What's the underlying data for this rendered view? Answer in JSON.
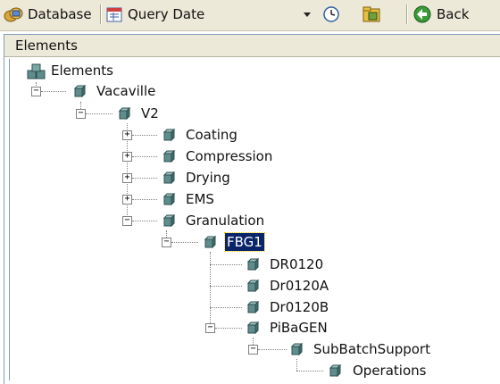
{
  "toolbar": {
    "database_label": "Database",
    "query_date_label": "Query Date",
    "back_label": "Back"
  },
  "panel": {
    "title": "Elements"
  },
  "tree": {
    "root": "Elements",
    "vacaville": "Vacaville",
    "v2": "V2",
    "coating": "Coating",
    "compression": "Compression",
    "drying": "Drying",
    "ems": "EMS",
    "granulation": "Granulation",
    "fbg1": "FBG1",
    "dr0120": "DR0120",
    "dr0120a": "Dr0120A",
    "dr0120b": "Dr0120B",
    "pibagen": "PiBaGEN",
    "subbatchsupport": "SubBatchSupport",
    "operations": "Operations"
  },
  "colors": {
    "selection": "#0a246a",
    "cube_face": "#5f8c8c",
    "toolbar_bg": "#ece9d8"
  }
}
